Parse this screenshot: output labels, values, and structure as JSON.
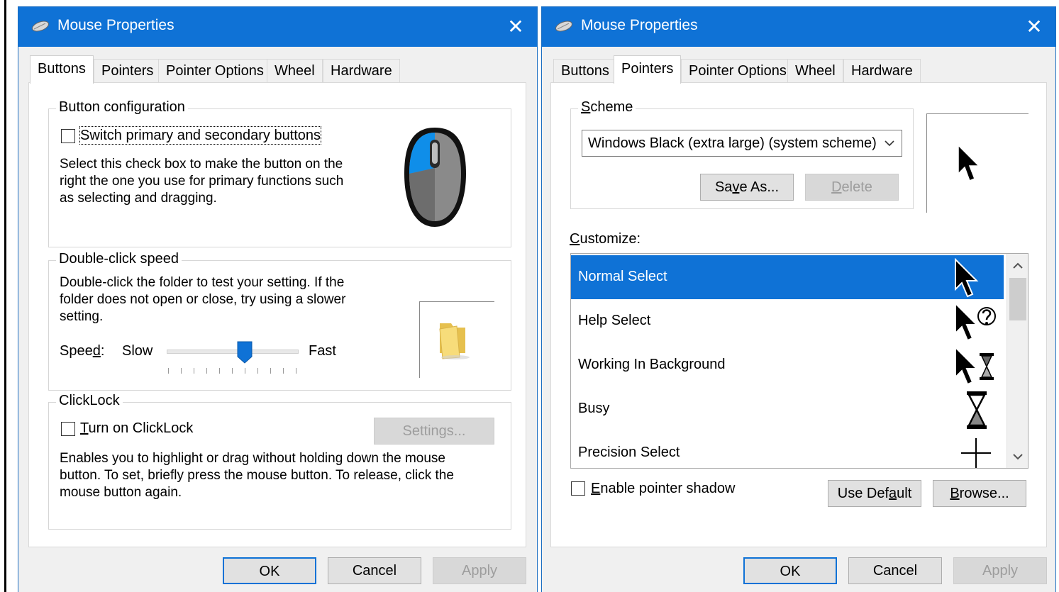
{
  "window1": {
    "title": "Mouse Properties",
    "close_glyph": "✕",
    "tabs": [
      {
        "label": "Buttons",
        "active": true
      },
      {
        "label": "Pointers",
        "active": false
      },
      {
        "label": "Pointer Options",
        "active": false
      },
      {
        "label": "Wheel",
        "active": false
      },
      {
        "label": "Hardware",
        "active": false
      }
    ],
    "button_config": {
      "group_label": "Button configuration",
      "checkbox_label": "Switch primary and secondary buttons",
      "checked": false,
      "description_lines": [
        "Select this check box to make the button on the",
        "right the one you use for primary functions such",
        "as selecting and dragging."
      ]
    },
    "double_click": {
      "group_label": "Double-click speed",
      "description_lines": [
        "Double-click the folder to test your setting. If the",
        "folder does not open or close, try using a slower",
        "setting."
      ],
      "speed_label_pre": "Spee",
      "speed_label_ul": "d",
      "speed_label_post": ":",
      "slow_label": "Slow",
      "fast_label": "Fast",
      "slider_value_fraction": 0.59
    },
    "clicklock": {
      "group_label": "ClickLock",
      "checkbox_label_ul": "T",
      "checkbox_label_rest": "urn on ClickLock",
      "checked": false,
      "settings_button": "Settings...",
      "description_lines": [
        "Enables you to highlight or drag without holding down the mouse",
        "button. To set, briefly press the mouse button. To release, click the",
        "mouse button again."
      ]
    },
    "footer": {
      "ok": "OK",
      "cancel": "Cancel",
      "apply": "Apply"
    }
  },
  "window2": {
    "title": "Mouse Properties",
    "close_glyph": "✕",
    "tabs": [
      {
        "label": "Buttons",
        "active": false
      },
      {
        "label": "Pointers",
        "active": true
      },
      {
        "label": "Pointer Options",
        "active": false
      },
      {
        "label": "Wheel",
        "active": false
      },
      {
        "label": "Hardware",
        "active": false
      }
    ],
    "scheme": {
      "group_label_ul": "S",
      "group_label_rest": "cheme",
      "selected": "Windows Black (extra large) (system scheme)",
      "save_as_pre": "Sa",
      "save_as_ul": "v",
      "save_as_post": "e As...",
      "delete_ul": "D",
      "delete_rest": "elete"
    },
    "customize": {
      "label_ul": "C",
      "label_rest": "ustomize:",
      "items": [
        {
          "label": "Normal Select",
          "icon": "arrow-cursor-icon",
          "selected": true
        },
        {
          "label": "Help Select",
          "icon": "help-cursor-icon",
          "selected": false
        },
        {
          "label": "Working In Background",
          "icon": "working-cursor-icon",
          "selected": false
        },
        {
          "label": "Busy",
          "icon": "hourglass-cursor-icon",
          "selected": false
        },
        {
          "label": "Precision Select",
          "icon": "crosshair-cursor-icon",
          "selected": false
        }
      ]
    },
    "shadow": {
      "label_ul": "E",
      "label_rest": "nable pointer shadow",
      "checked": false
    },
    "use_default_pre": "Use Def",
    "use_default_ul": "a",
    "use_default_post": "ult",
    "browse_ul": "B",
    "browse_rest": "rowse...",
    "footer": {
      "ok": "OK",
      "cancel": "Cancel",
      "apply": "Apply"
    }
  },
  "colors": {
    "title_bar": "#0f72d6",
    "selection": "#0f72d6",
    "dialog_bg": "#f0f0f0"
  }
}
